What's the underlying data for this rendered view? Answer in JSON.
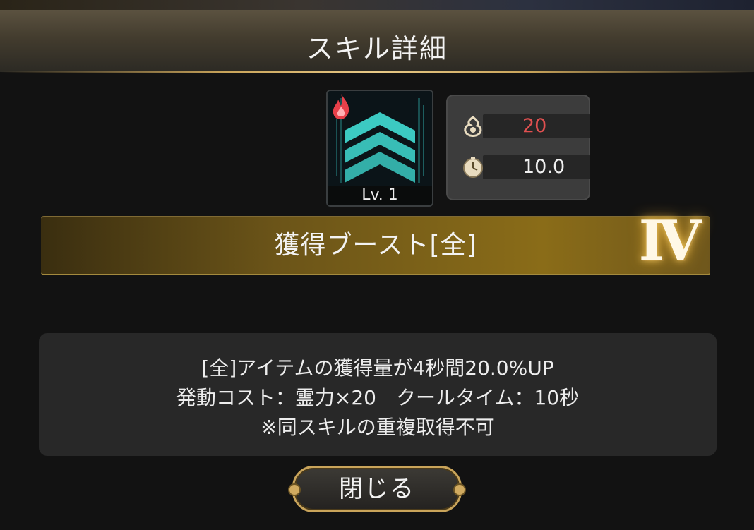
{
  "header": {
    "title": "スキル詳細"
  },
  "skill": {
    "level_label": "Lv. 1",
    "icon": "chevron-up-rank-icon",
    "element_icon": "fire-icon",
    "name": "獲得ブースト[全]",
    "rank": "Ⅳ"
  },
  "stats": {
    "cost": {
      "icon": "spirit-flame-icon",
      "value": "20",
      "color": "#e05050"
    },
    "cooldown": {
      "icon": "stopwatch-icon",
      "value": "10.0",
      "color": "#f0f0f0"
    }
  },
  "description": {
    "line1": "[全]アイテムの獲得量が4秒間20.0%UP",
    "line2": "発動コスト：霊力×20　クールタイム：10秒",
    "line3": "※同スキルの重複取得不可"
  },
  "buttons": {
    "close_label": "閉じる"
  },
  "colors": {
    "accent_gold": "#c9a45a",
    "cost_red": "#e05050",
    "icon_teal": "#3fd0c8"
  }
}
